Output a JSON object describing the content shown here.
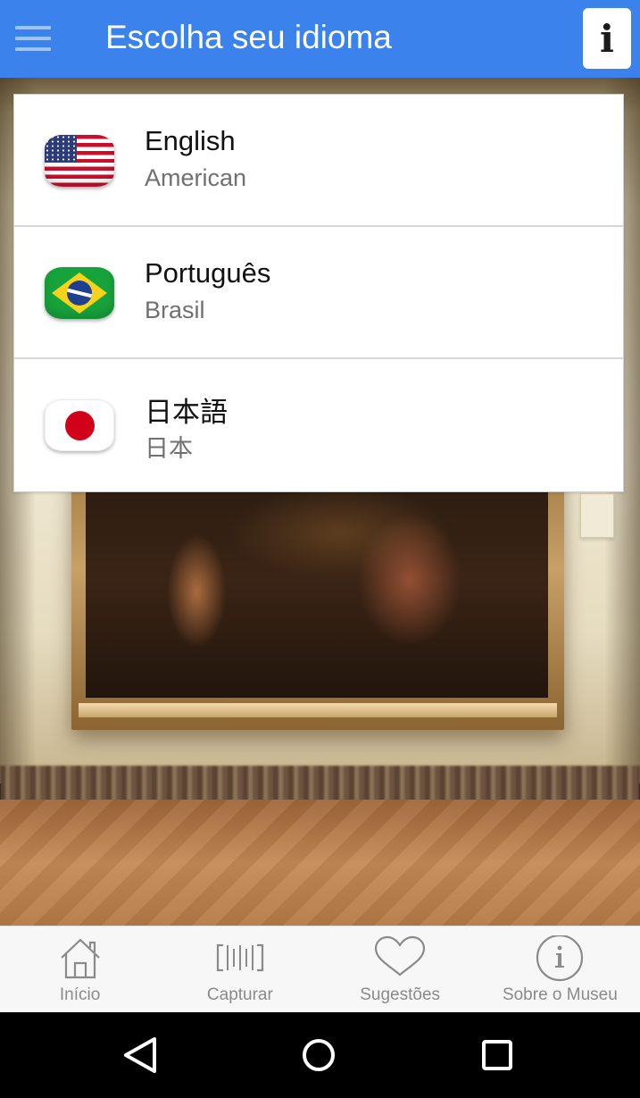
{
  "app_bar": {
    "title": "Escolha seu idioma",
    "info_label": "i",
    "color": "#3b82ed"
  },
  "languages": [
    {
      "name": "English",
      "region": "American",
      "flag": "us-flag-icon"
    },
    {
      "name": "Português",
      "region": "Brasil",
      "flag": "brazil-flag-icon"
    },
    {
      "name": "日本語",
      "region": "日本",
      "flag": "japan-flag-icon"
    }
  ],
  "tabs": [
    {
      "label": "Início",
      "icon": "home-icon"
    },
    {
      "label": "Capturar",
      "icon": "barcode-icon"
    },
    {
      "label": "Sugestões",
      "icon": "heart-icon"
    },
    {
      "label": "Sobre o Museu",
      "icon": "info-circle-icon"
    }
  ],
  "tab_icon_color": "#8a8a8a",
  "system_nav": [
    "back-icon",
    "home-circle-icon",
    "recent-apps-icon"
  ]
}
